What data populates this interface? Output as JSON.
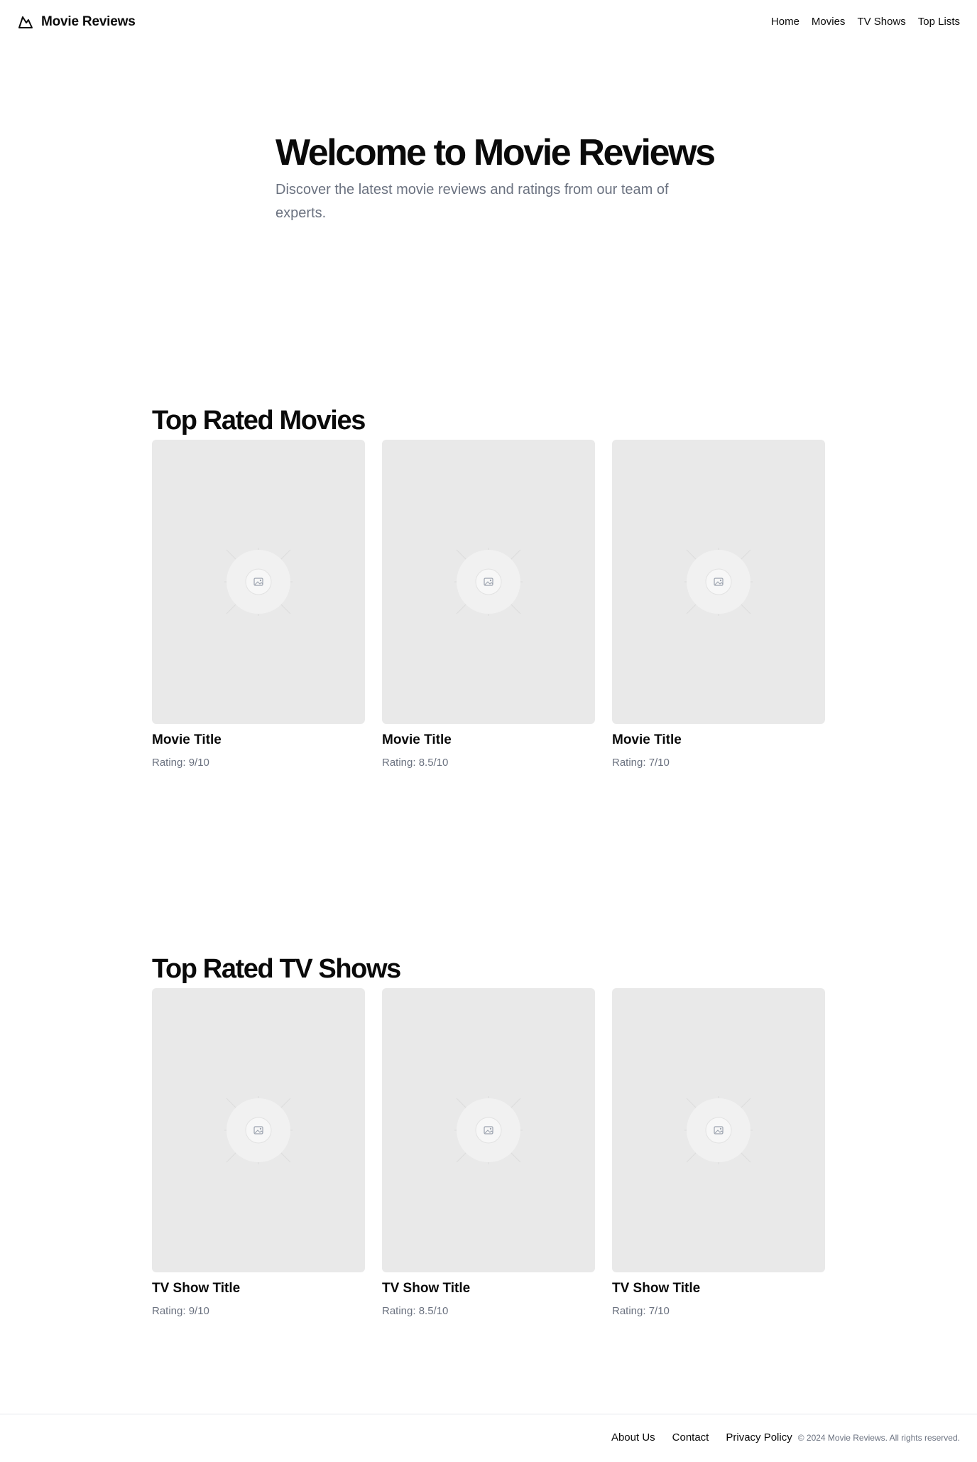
{
  "header": {
    "brand": "Movie Reviews",
    "brand_icon": "mountain-icon",
    "nav": [
      "Home",
      "Movies",
      "TV Shows",
      "Top Lists"
    ]
  },
  "hero": {
    "title": "Welcome to Movie Reviews",
    "subtitle": "Discover the latest movie reviews and ratings from our team of experts."
  },
  "movies": {
    "heading": "Top Rated Movies",
    "items": [
      {
        "title": "Movie Title",
        "rating": "Rating: 9/10"
      },
      {
        "title": "Movie Title",
        "rating": "Rating: 8.5/10"
      },
      {
        "title": "Movie Title",
        "rating": "Rating: 7/10"
      }
    ]
  },
  "tv": {
    "heading": "Top Rated TV Shows",
    "items": [
      {
        "title": "TV Show Title",
        "rating": "Rating: 9/10"
      },
      {
        "title": "TV Show Title",
        "rating": "Rating: 8.5/10"
      },
      {
        "title": "TV Show Title",
        "rating": "Rating: 7/10"
      }
    ]
  },
  "footer": {
    "links": [
      "About Us",
      "Contact",
      "Privacy Policy"
    ],
    "copyright": "© 2024 Movie Reviews. All rights reserved."
  },
  "colors": {
    "text": "#0a0a0a",
    "muted": "#6b7280",
    "placeholder_bg": "#e9e9e9",
    "border": "#e5e7eb"
  },
  "icons": {
    "placeholder": "image-placeholder-icon"
  }
}
